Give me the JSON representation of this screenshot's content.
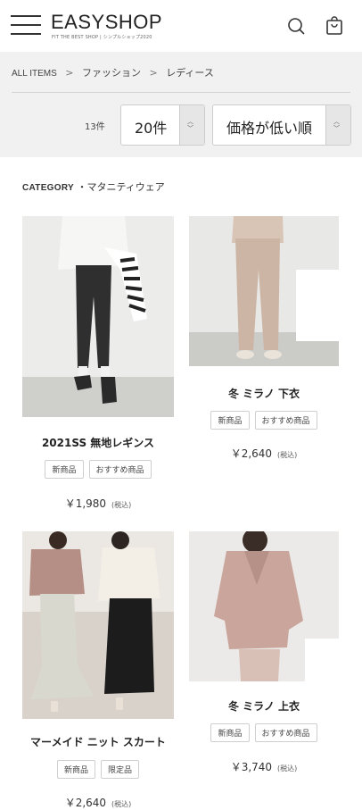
{
  "header": {
    "logo": "EASYSHOP",
    "tagline": "FIT THE BEST SHOP | シンプルショップ2020"
  },
  "breadcrumb": [
    {
      "label": "ALL ITEMS"
    },
    {
      "label": "ファッション"
    },
    {
      "label": "レディース"
    }
  ],
  "breadcrumb_sep": ">",
  "filter": {
    "count": "13件",
    "per_page": "20件",
    "sort": "価格が低い順"
  },
  "category": {
    "label": "CATEGORY",
    "value": "・マタニティウェア"
  },
  "products": [
    {
      "name": "2021SS 無地レギンス",
      "tags": [
        "新商品",
        "おすすめ商品"
      ],
      "price": "￥1,980",
      "tax": "(税込)"
    },
    {
      "name": "冬 ミラノ 下衣",
      "tags": [
        "新商品",
        "おすすめ商品"
      ],
      "price": "￥2,640",
      "tax": "(税込)"
    },
    {
      "name": "マーメイド ニット スカート",
      "tags": [
        "新商品",
        "限定品"
      ],
      "price": "￥2,640",
      "tax": "(税込)"
    },
    {
      "name": "冬 ミラノ 上衣",
      "tags": [
        "新商品",
        "おすすめ商品"
      ],
      "price": "￥3,740",
      "tax": "(税込)"
    }
  ],
  "colors": {
    "background_grey": "#f1f1f1",
    "text": "#222222",
    "border": "#cccccc"
  }
}
